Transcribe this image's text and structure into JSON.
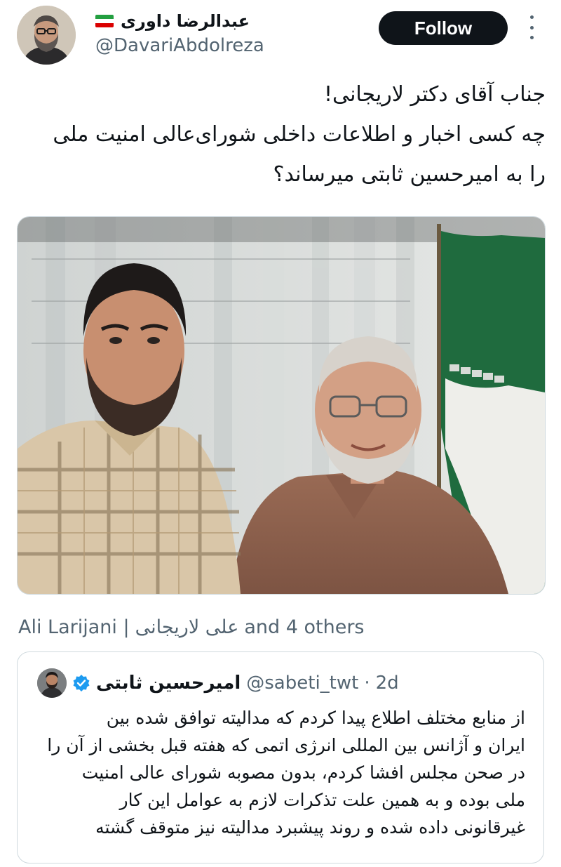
{
  "author": {
    "display_name": "عبدالرضا داوری",
    "handle": "@DavariAbdolreza",
    "flag_icon": "iran-flag-icon"
  },
  "actions": {
    "follow_label": "Follow",
    "more_icon": "more-options-icon"
  },
  "tweet": {
    "lines": [
      "جناب آقای دکتر لاریجانی!",
      "چه کسی اخبار و اطلاعات داخلی شورای‌عالی امنیت ملی",
      "را به امیرحسین ثابتی میرساند؟"
    ]
  },
  "media": {
    "type": "photo"
  },
  "tagged": {
    "name_en": "Ali Larijani |",
    "name_fa": "علی لاریجانی",
    "others": "and 4 others"
  },
  "quoted": {
    "display_name": "امیرحسین ثابتی",
    "verified_icon": "verified-badge-icon",
    "handle": "@sabeti_twt",
    "separator": "·",
    "time": "2d",
    "lines": [
      "از منابع مختلف اطلاع پیدا کردم که مدالیته توافق شده بین",
      "ایران و آژانس بین المللی انرژی اتمی که هفته قبل بخشی از آن را",
      "در صحن مجلس افشا کردم، بدون مصوبه شورای عالی امنیت",
      "ملی بوده و به همین علت تذکرات لازم به عوامل این کار",
      "غیرقانونی داده شده و روند پیشبرد مدالیته نیز متوقف گشته"
    ]
  },
  "colors": {
    "text": "#0f1419",
    "secondary": "#536471",
    "border": "#cfd9de",
    "verified": "#1d9bf0",
    "follow_bg": "#0f1419"
  }
}
